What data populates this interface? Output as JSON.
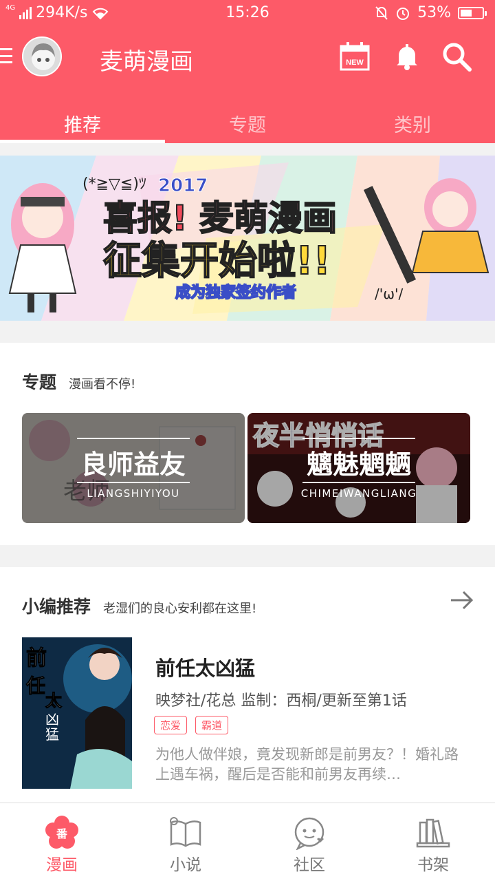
{
  "status_bar": {
    "network_tag": "4G",
    "speed": "294K/s",
    "time": "15:26",
    "battery_percent": "53%",
    "battery_level": 0.53
  },
  "app_bar": {
    "title": "麦萌漫画",
    "calendar_badge": "NEW",
    "tabs": [
      {
        "label": "推荐",
        "active": true
      },
      {
        "label": "专题",
        "active": false
      },
      {
        "label": "类别",
        "active": false
      }
    ]
  },
  "banner": {
    "emote_left": "(*≧▽≦)ﾂ",
    "year": "2017",
    "line1_a": "喜报!",
    "line1_b": "麦萌漫画",
    "line2": "征集开始啦!!",
    "caption": "成为独家签约作者",
    "emote_right": "/'ω'/"
  },
  "topics_section": {
    "title": "专题",
    "subtitle": "漫画看不停!",
    "cards": [
      {
        "name": "良师益友",
        "pinyin": "LIANGSHIYIYOU"
      },
      {
        "name": "魑魅魍魉",
        "pinyin": "CHIMEIWANGLIANG",
        "bg_text": "夜半悄悄话"
      }
    ]
  },
  "editor_section": {
    "title": "小编推荐",
    "subtitle": "老湿们的良心安利都在这里!",
    "comic": {
      "cover_text": "前任太凶猛",
      "title": "前任太凶猛",
      "meta": "映梦社/花总 监制：西桐/更新至第1话",
      "tags": [
        "恋爱",
        "霸道"
      ],
      "description": "为他人做伴娘，竟发现新郎是前男友？！婚礼路上遇车祸，醒后是否能和前男友再续…"
    }
  },
  "bottom_nav": {
    "items": [
      {
        "label": "漫画",
        "icon": "flower-icon",
        "badge": "番",
        "active": true
      },
      {
        "label": "小说",
        "icon": "book-icon",
        "active": false
      },
      {
        "label": "社区",
        "icon": "chat-face-icon",
        "active": false
      },
      {
        "label": "书架",
        "icon": "bookshelf-icon",
        "active": false
      }
    ]
  },
  "colors": {
    "accent": "#fd5a68",
    "background": "#f2f2f2"
  }
}
